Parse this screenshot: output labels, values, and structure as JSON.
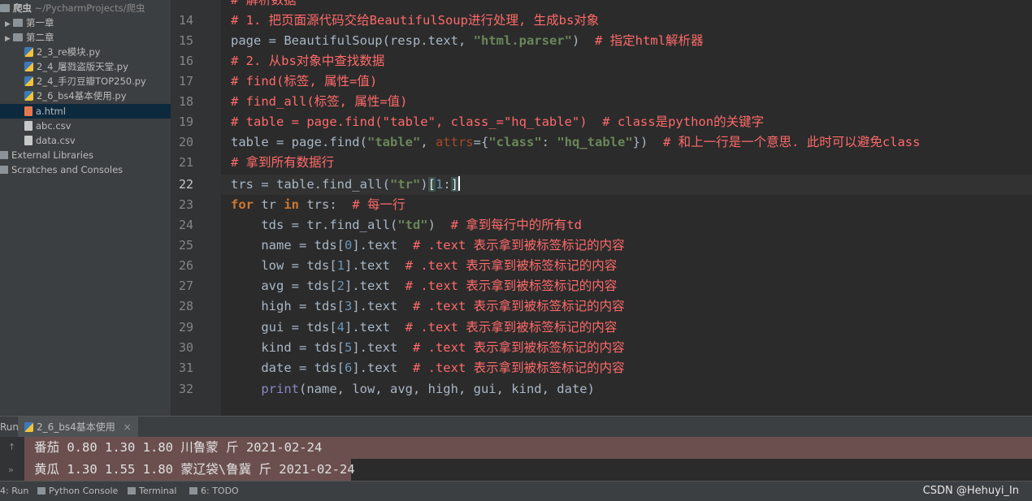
{
  "project_tree": {
    "root": {
      "label": "爬虫",
      "path": "~/PycharmProjects/爬虫"
    },
    "items": [
      {
        "label": "第一章",
        "type": "folder"
      },
      {
        "label": "第二章",
        "type": "folder"
      },
      {
        "label": "2_3_re模块.py",
        "type": "py"
      },
      {
        "label": "2_4_屠戮盗版天堂.py",
        "type": "py"
      },
      {
        "label": "2_4_手刃豆瓣TOP250.py",
        "type": "py"
      },
      {
        "label": "2_6_bs4基本使用.py",
        "type": "py"
      },
      {
        "label": "a.html",
        "type": "html"
      },
      {
        "label": "abc.csv",
        "type": "csv"
      },
      {
        "label": "data.csv",
        "type": "csv"
      },
      {
        "label": "External Libraries",
        "type": "lib"
      },
      {
        "label": "Scratches and Consoles",
        "type": "scratch"
      }
    ]
  },
  "editor": {
    "line_numbers": [
      "14",
      "15",
      "16",
      "17",
      "18",
      "19",
      "20",
      "21",
      "22",
      "23",
      "24",
      "25",
      "26",
      "27",
      "28",
      "29",
      "30",
      "31",
      "32"
    ],
    "current_line": "22",
    "top_partial_comment": "# 解析数据"
  },
  "run_panel": {
    "tab_prefix": "Run:",
    "tab_label": "2_6_bs4基本使用",
    "output": [
      "番茄 0.80 1.30 1.80 川鲁蒙 斤 2021-02-24",
      "黄瓜 1.30 1.55 1.80 蒙辽袋\\鲁冀 斤 2021-02-24"
    ]
  },
  "bottom_bar": {
    "tabs": [
      "4: Run",
      "Python Console",
      "Terminal",
      "6: TODO"
    ],
    "watermark": "CSDN @Hehuyi_In"
  },
  "colors": {
    "comment": "#ff6a6a",
    "keyword": "#cc7832",
    "string": "#6a8759",
    "number": "#6897bb",
    "selection": "#0d293e"
  }
}
